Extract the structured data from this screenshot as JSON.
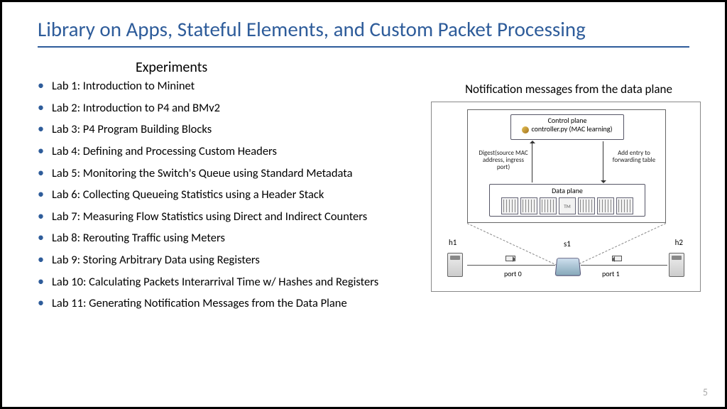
{
  "title": "Library on Apps, Stateful Elements, and Custom Packet Processing",
  "experiments_heading": "Experiments",
  "labs": [
    "Lab 1: Introduction to Mininet",
    "Lab 2: Introduction to P4 and BMv2",
    "Lab 3: P4 Program Building Blocks",
    "Lab 4: Defining and Processing Custom Headers",
    "Lab 5: Monitoring the Switch's Queue using Standard Metadata",
    "Lab 6: Collecting Queueing Statistics using a Header Stack",
    "Lab 7: Measuring Flow Statistics using Direct and Indirect Counters",
    "Lab 8: Rerouting Traffic using Meters",
    "Lab 9: Storing Arbitrary Data using Registers",
    "Lab 10: Calculating Packets Interarrival Time w/ Hashes and Registers",
    "Lab 11: Generating Notification Messages from the Data Plane"
  ],
  "figure": {
    "caption": "Notification messages from the data plane",
    "control_plane_title": "Control plane",
    "control_plane_sub": "controller.py (MAC learning)",
    "digest_label": "Digest(source MAC address, ingress port)",
    "add_label": "Add entry to forwarding table",
    "data_plane_title": "Data plane",
    "tm_label": "TM",
    "h1": "h1",
    "h2": "h2",
    "s1": "s1",
    "port0": "port 0",
    "port1": "port 1"
  },
  "page_number": "5"
}
